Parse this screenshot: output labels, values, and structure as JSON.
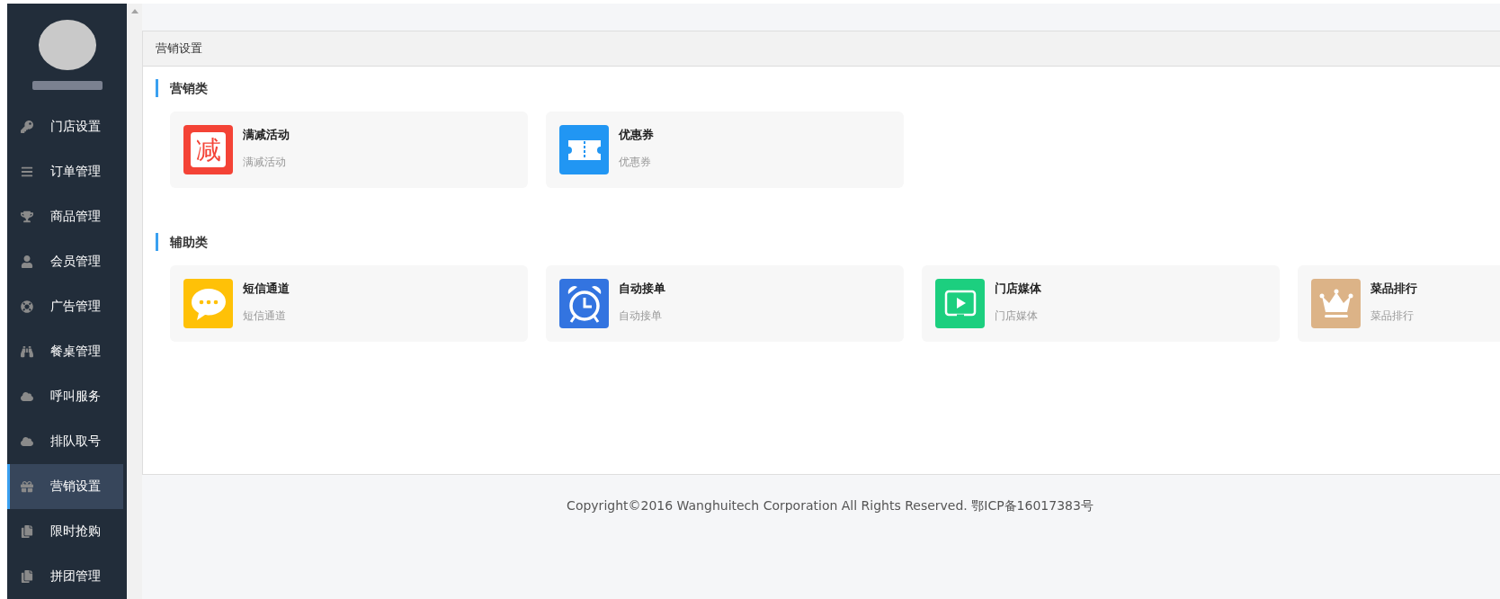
{
  "sidebar": {
    "items": [
      {
        "label": "门店设置",
        "kind": "key",
        "selected": false
      },
      {
        "label": "订单管理",
        "kind": "bars",
        "selected": false
      },
      {
        "label": "商品管理",
        "kind": "trophy",
        "selected": false
      },
      {
        "label": "会员管理",
        "kind": "user",
        "selected": false
      },
      {
        "label": "广告管理",
        "kind": "lifering",
        "selected": false
      },
      {
        "label": "餐桌管理",
        "kind": "binoculars",
        "selected": false
      },
      {
        "label": "呼叫服务",
        "kind": "cloud",
        "selected": false
      },
      {
        "label": "排队取号",
        "kind": "cloud",
        "selected": false
      },
      {
        "label": "营销设置",
        "kind": "gift",
        "selected": true
      },
      {
        "label": "限时抢购",
        "kind": "copy",
        "selected": false
      },
      {
        "label": "拼团管理",
        "kind": "copy",
        "selected": false
      }
    ]
  },
  "panel": {
    "title": "营销设置",
    "sections": [
      {
        "title": "营销类",
        "cards": [
          {
            "title": "满减活动",
            "subtitle": "满减活动",
            "kind": "glyph",
            "glyph": "减",
            "color": "#f44336"
          },
          {
            "title": "优惠券",
            "subtitle": "优惠券",
            "kind": "ticket",
            "color": "#2196f3"
          }
        ]
      },
      {
        "title": "辅助类",
        "cards": [
          {
            "title": "短信通道",
            "subtitle": "短信通道",
            "kind": "chat",
            "color": "#ffc107"
          },
          {
            "title": "自动接单",
            "subtitle": "自动接单",
            "kind": "alarm",
            "color": "#3374e0"
          },
          {
            "title": "门店媒体",
            "subtitle": "门店媒体",
            "kind": "play",
            "color": "#1ccf7f"
          },
          {
            "title": "菜品排行",
            "subtitle": "菜品排行",
            "kind": "crown",
            "color": "#dcb387"
          }
        ]
      }
    ]
  },
  "footer": "Copyright©2016 Wanghuitech Corporation All Rights Reserved. 鄂ICP备16017383号"
}
